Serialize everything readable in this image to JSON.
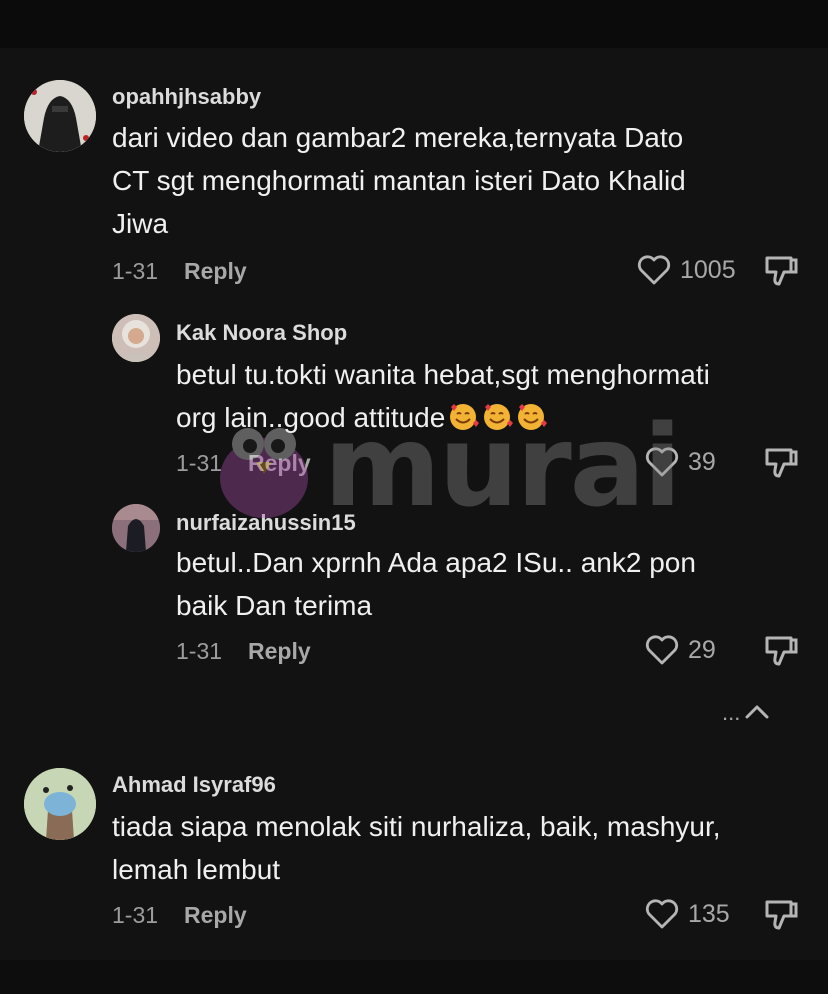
{
  "comments": [
    {
      "username": "opahhjhsabby",
      "text_lines": [
        "dari video dan gambar2 mereka,ternyata Dato",
        "CT sgt menghormati mantan isteri Dato Khalid",
        "Jiwa"
      ],
      "date": "1-31",
      "reply_label": "Reply",
      "likes": "1005"
    },
    {
      "username": "Kak Noora Shop",
      "text_lines": [
        "betul tu.tokti wanita hebat,sgt menghormati",
        "org lain..good attitude"
      ],
      "date": "1-31",
      "reply_label": "Reply",
      "likes": "39"
    },
    {
      "username": "nurfaizahussin15",
      "text_lines": [
        "betul..Dan xprnh Ada apa2 ISu.. ank2 pon",
        "baik Dan terima"
      ],
      "date": "1-31",
      "reply_label": "Reply",
      "likes": "29"
    },
    {
      "username": "Ahmad Isyraf96",
      "text_lines": [
        "tiada siapa menolak siti nurhaliza, baik, mashyur,",
        "lemah lembut"
      ],
      "date": "1-31",
      "reply_label": "Reply",
      "likes": "135"
    }
  ],
  "collapse_replies": {
    "dots": "...",
    "icon": "chevron-up-icon"
  },
  "watermark": {
    "text": "murai"
  },
  "emojis": {
    "icon": "smiling-face-with-hearts-icon",
    "count": 3
  },
  "colors": {
    "background": "#121212",
    "text": "#f0f0f0",
    "secondary": "#a8a8a8"
  }
}
